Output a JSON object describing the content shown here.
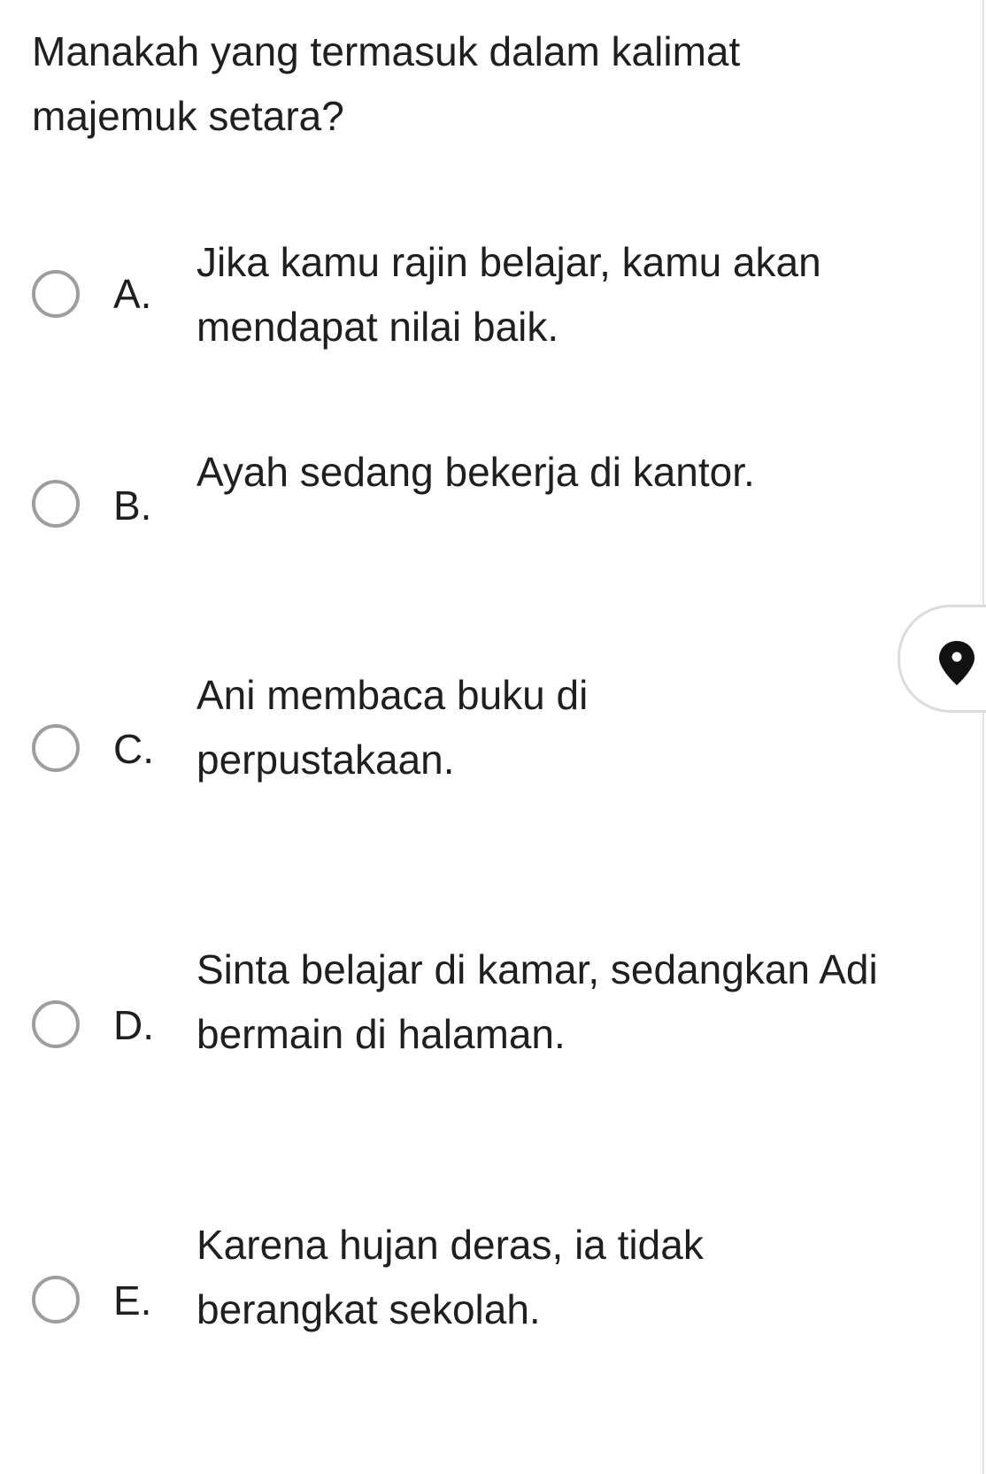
{
  "question": {
    "text": "Manakah yang termasuk dalam kalimat majemuk setara?"
  },
  "options": [
    {
      "letter": "A.",
      "text": "Jika kamu rajin belajar, kamu akan mendapat nilai baik."
    },
    {
      "letter": "B.",
      "text": "Ayah sedang bekerja di kantor."
    },
    {
      "letter": "C.",
      "text": "Ani membaca buku di perpustakaan."
    },
    {
      "letter": "D.",
      "text": "Sinta belajar di kamar, sedangkan Adi bermain di halaman."
    },
    {
      "letter": "E.",
      "text": "Karena hujan deras, ia tidak berangkat sekolah."
    }
  ],
  "floating_tab": {
    "icon": "location-pin-icon"
  },
  "colors": {
    "text": "#1f1f1f",
    "radio_border": "#9e9e9e",
    "tab_border": "#dcdcdc",
    "pin": "#111111"
  }
}
